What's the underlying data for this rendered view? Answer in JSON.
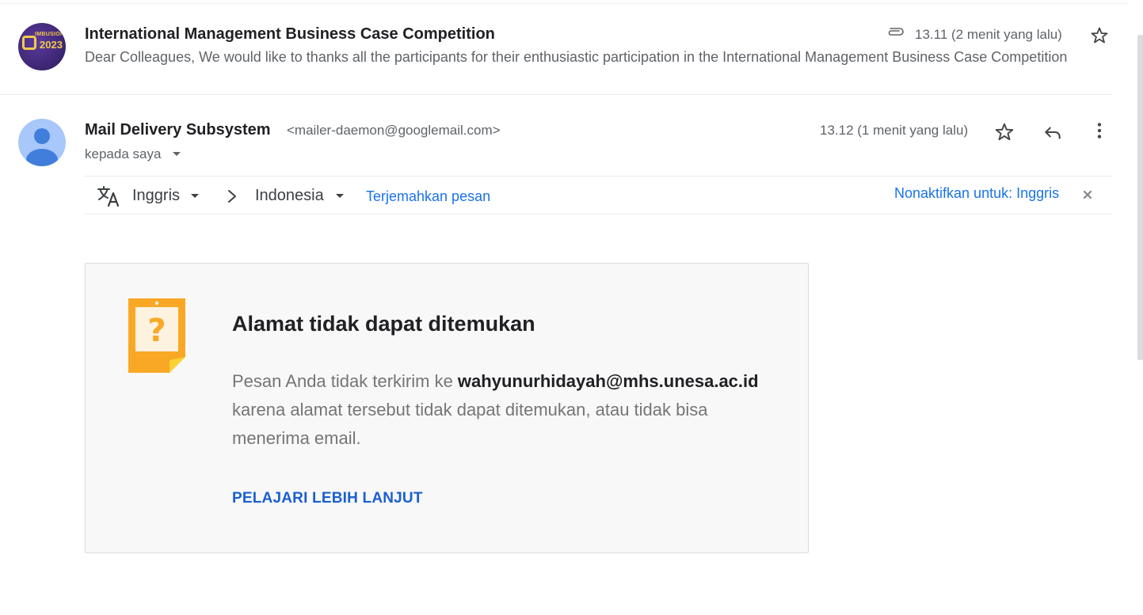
{
  "thread": {
    "collapsed_message": {
      "subject": "International Management Business Case Competition",
      "snippet": "Dear Colleagues, We would like to thanks all the participants for their enthusiastic participation in the International Management Business Case Competition",
      "time": "13.11 (2 menit yang lalu)",
      "avatar_text_small": "IMBUSION",
      "avatar_text_year": "2023"
    },
    "message": {
      "sender_name": "Mail Delivery Subsystem",
      "sender_email": "<mailer-daemon@googlemail.com>",
      "recipient_label": "kepada saya",
      "time": "13.12 (1 menit yang lalu)"
    },
    "translate": {
      "from_lang": "Inggris",
      "to_lang": "Indonesia",
      "action": "Terjemahkan pesan",
      "disable": "Nonaktifkan untuk: Inggris"
    },
    "bounce": {
      "title": "Alamat tidak dapat ditemukan",
      "body_prefix": "Pesan Anda tidak terkirim ke ",
      "address": "wahyunurhidayah@mhs.unesa.ac.id",
      "body_suffix": " karena alamat tersebut tidak dapat ditemukan, atau tidak bisa menerima email.",
      "link": "PELAJARI LEBIH LANJUT"
    }
  },
  "icons": {
    "attachment": "paperclip-icon",
    "star": "star-outline-icon",
    "reply": "reply-icon",
    "more": "more-vert-icon",
    "translate": "translate-icon",
    "close": "close-icon",
    "bounce": "question-note-icon"
  },
  "colors": {
    "link_blue": "#1a73e8",
    "bounce_icon_orange": "#f9a825",
    "avatar_default": "#a8c7fa",
    "card_background": "#f8f8f8"
  }
}
